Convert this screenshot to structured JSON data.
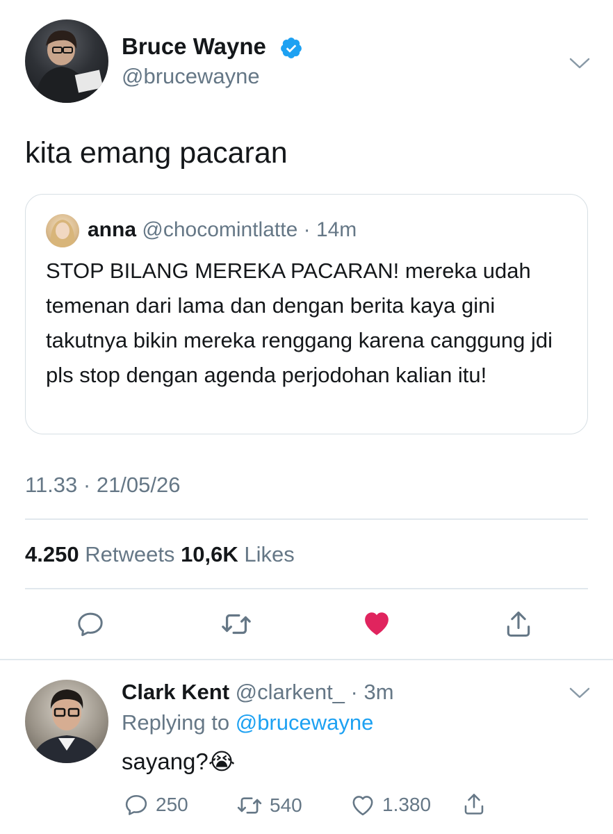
{
  "tweet": {
    "author_name": "Bruce Wayne",
    "author_handle": "@brucewayne",
    "text": "kita emang pacaran",
    "timestamp": "11.33 · 21/05/26",
    "retweets_count": "4.250",
    "retweets_label": "Retweets",
    "likes_count": "10,6K",
    "likes_label": "Likes",
    "liked": true,
    "heart_color": "#e0245e"
  },
  "quote": {
    "author_name": "anna",
    "author_handle": "@chocomintlatte",
    "time": "14m",
    "text": "STOP BILANG MEREKA PACARAN! mereka udah temenan dari lama dan dengan berita kaya gini takutnya bikin mereka renggang karena canggung jdi pls stop dengan agenda perjodohan kalian itu!"
  },
  "reply": {
    "author_name": "Clark Kent",
    "author_handle": "@clarkent_",
    "time": "3m",
    "replying_prefix": "Replying to",
    "replying_to": "@brucewayne",
    "text": "sayang?",
    "emoji": "😭",
    "reply_count": "250",
    "retweet_count": "540",
    "like_count": "1.380"
  },
  "colors": {
    "link": "#1da1f2",
    "muted": "#657786",
    "divider": "#e1e8ed"
  },
  "icons": [
    "verified-badge-icon",
    "chevron-down-icon",
    "reply-icon",
    "retweet-icon",
    "heart-icon",
    "share-icon"
  ]
}
